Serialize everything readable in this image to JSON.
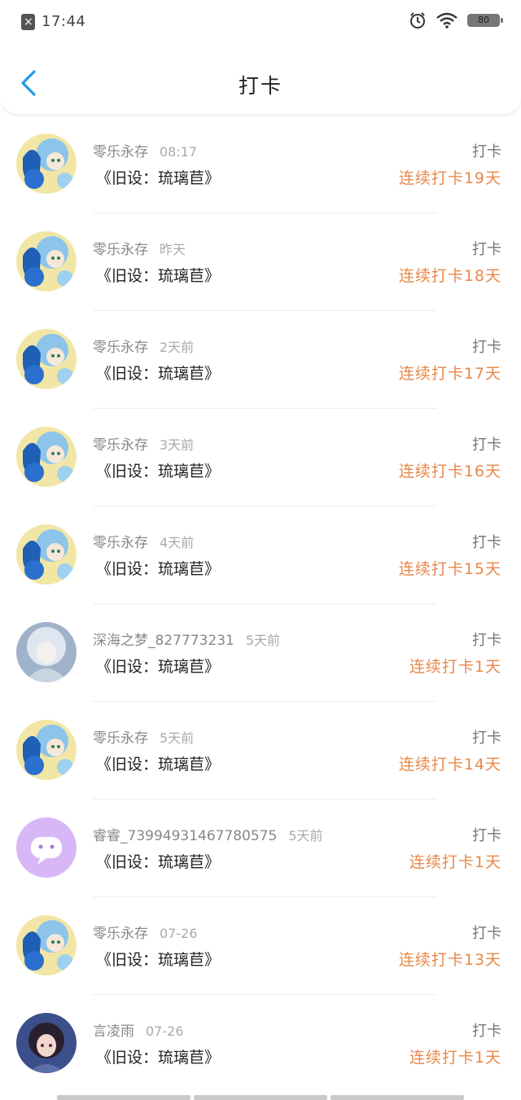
{
  "status_bar": {
    "time": "17:44",
    "battery": "80",
    "icons": [
      "notification-x-icon",
      "alarm-icon",
      "wifi-icon",
      "battery-icon"
    ]
  },
  "header": {
    "title": "打卡",
    "back_icon": "chevron-left-icon",
    "accent": "#1e9be8"
  },
  "colors": {
    "streak": "#e8884a",
    "meta": "#888888",
    "time": "#aaaaaa"
  },
  "rows": [
    {
      "user": "零乐永存",
      "time": "08:17",
      "book": "《旧设：琉璃苣》",
      "action": "打卡",
      "streak": "连续打卡19天",
      "avatar": "blue-anime"
    },
    {
      "user": "零乐永存",
      "time": "昨天",
      "book": "《旧设：琉璃苣》",
      "action": "打卡",
      "streak": "连续打卡18天",
      "avatar": "blue-anime"
    },
    {
      "user": "零乐永存",
      "time": "2天前",
      "book": "《旧设：琉璃苣》",
      "action": "打卡",
      "streak": "连续打卡17天",
      "avatar": "blue-anime"
    },
    {
      "user": "零乐永存",
      "time": "3天前",
      "book": "《旧设：琉璃苣》",
      "action": "打卡",
      "streak": "连续打卡16天",
      "avatar": "blue-anime"
    },
    {
      "user": "零乐永存",
      "time": "4天前",
      "book": "《旧设：琉璃苣》",
      "action": "打卡",
      "streak": "连续打卡15天",
      "avatar": "blue-anime"
    },
    {
      "user": "深海之梦_827773231",
      "time": "5天前",
      "book": "《旧设：琉璃苣》",
      "action": "打卡",
      "streak": "连续打卡1天",
      "avatar": "silver-girl"
    },
    {
      "user": "零乐永存",
      "time": "5天前",
      "book": "《旧设：琉璃苣》",
      "action": "打卡",
      "streak": "连续打卡14天",
      "avatar": "blue-anime"
    },
    {
      "user": "睿睿_73994931467780575",
      "time": "5天前",
      "book": "《旧设：琉璃苣》",
      "action": "打卡",
      "streak": "连续打卡1天",
      "avatar": "purple-chat"
    },
    {
      "user": "零乐永存",
      "time": "07-26",
      "book": "《旧设：琉璃苣》",
      "action": "打卡",
      "streak": "连续打卡13天",
      "avatar": "blue-anime"
    },
    {
      "user": "言凌雨",
      "time": "07-26",
      "book": "《旧设：琉璃苣》",
      "action": "打卡",
      "streak": "连续打卡1天",
      "avatar": "dark-girl"
    }
  ]
}
